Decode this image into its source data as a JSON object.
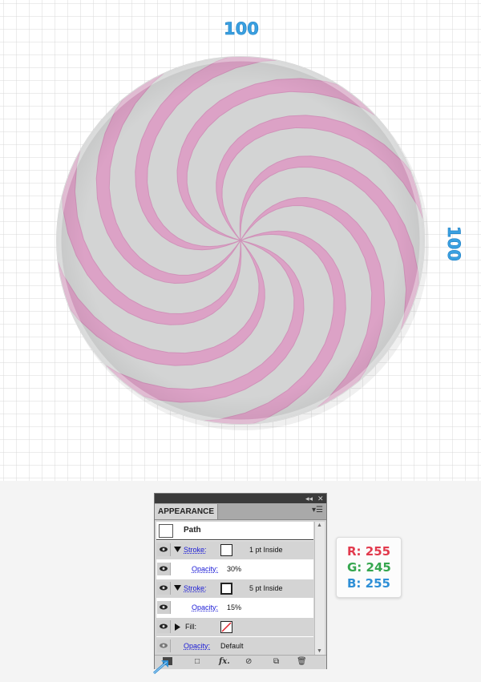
{
  "artboard": {
    "width_label": "100",
    "height_label": "100"
  },
  "candy": {
    "base_color": "#d3d4d4",
    "stripe_color": "#dca2c6",
    "stripe_dark": "#d092b9",
    "stripe_count": 10
  },
  "appearance_panel": {
    "tab_label": "APPEARANCE",
    "path_label": "Path",
    "rows": [
      {
        "kind": "stroke",
        "label": "Stroke:",
        "value": "1 pt  Inside"
      },
      {
        "kind": "opacity",
        "label": "Opacity:",
        "value": "30%"
      },
      {
        "kind": "stroke",
        "label": "Stroke:",
        "value": "5 pt  Inside"
      },
      {
        "kind": "opacity",
        "label": "Opacity:",
        "value": "15%"
      },
      {
        "kind": "fill",
        "label": "Fill:",
        "value": ""
      },
      {
        "kind": "opacity",
        "label": "Opacity:",
        "value": "Default"
      }
    ],
    "icons": [
      "collapse-icon",
      "close-icon",
      "panel-menu-icon",
      "eye-icon",
      "new-art-icon",
      "add-stroke-icon",
      "fx-icon",
      "clear-icon",
      "duplicate-icon",
      "delete-icon"
    ]
  },
  "color_info": {
    "r": "R: 255",
    "g": "G: 245",
    "b": "B: 255",
    "r_color": "#e23a4d",
    "g_color": "#35a64e",
    "b_color": "#2e8fd6"
  }
}
